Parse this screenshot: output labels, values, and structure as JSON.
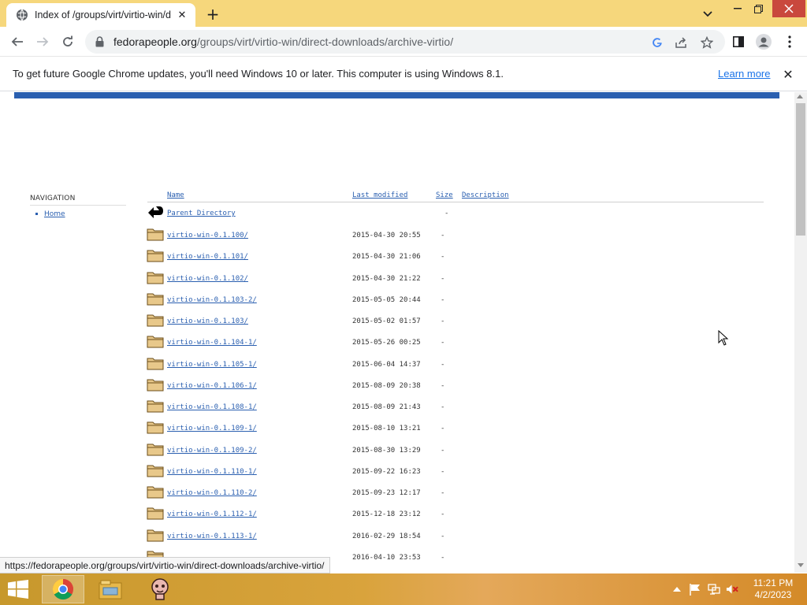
{
  "window": {
    "tab_title": "Index of /groups/virt/virtio-win/d",
    "tab_icons": {
      "favicon": "globe-icon",
      "close": "close-icon"
    },
    "new_tab_label": "+",
    "accent_color": "#f6d77c"
  },
  "toolbar": {
    "url_host": "fedorapeople.org",
    "url_path": "/groups/virt/virtio-win/direct-downloads/archive-virtio/",
    "icons": [
      "back-arrow-icon",
      "forward-arrow-icon",
      "reload-icon",
      "lock-icon",
      "google-icon",
      "share-icon",
      "star-icon",
      "side-panel-icon",
      "profile-icon",
      "kebab-menu-icon"
    ]
  },
  "infobar": {
    "message": "To get future Google Chrome updates, you'll need Windows 10 or later. This computer is using Windows 8.1.",
    "link": "Learn more",
    "close": "✕"
  },
  "page": {
    "navigation": {
      "heading": "NAVIGATION",
      "items": [
        "Home"
      ]
    },
    "columns": {
      "name": "Name",
      "last_modified": "Last modified",
      "size": "Size",
      "description": "Description"
    },
    "parent": {
      "name": "Parent Directory",
      "size": "-"
    },
    "rows": [
      {
        "name": "virtio-win-0.1.100/",
        "modified": "2015-04-30 20:55",
        "size": "-"
      },
      {
        "name": "virtio-win-0.1.101/",
        "modified": "2015-04-30 21:06",
        "size": "-"
      },
      {
        "name": "virtio-win-0.1.102/",
        "modified": "2015-04-30 21:22",
        "size": "-"
      },
      {
        "name": "virtio-win-0.1.103-2/",
        "modified": "2015-05-05 20:44",
        "size": "-"
      },
      {
        "name": "virtio-win-0.1.103/",
        "modified": "2015-05-02 01:57",
        "size": "-"
      },
      {
        "name": "virtio-win-0.1.104-1/",
        "modified": "2015-05-26 00:25",
        "size": "-"
      },
      {
        "name": "virtio-win-0.1.105-1/",
        "modified": "2015-06-04 14:37",
        "size": "-"
      },
      {
        "name": "virtio-win-0.1.106-1/",
        "modified": "2015-08-09 20:38",
        "size": "-"
      },
      {
        "name": "virtio-win-0.1.108-1/",
        "modified": "2015-08-09 21:43",
        "size": "-"
      },
      {
        "name": "virtio-win-0.1.109-1/",
        "modified": "2015-08-10 13:21",
        "size": "-"
      },
      {
        "name": "virtio-win-0.1.109-2/",
        "modified": "2015-08-30 13:29",
        "size": "-"
      },
      {
        "name": "virtio-win-0.1.110-1/",
        "modified": "2015-09-22 16:23",
        "size": "-"
      },
      {
        "name": "virtio-win-0.1.110-2/",
        "modified": "2015-09-23 12:17",
        "size": "-"
      },
      {
        "name": "virtio-win-0.1.112-1/",
        "modified": "2015-12-18 23:12",
        "size": "-"
      },
      {
        "name": "virtio-win-0.1.113-1/",
        "modified": "2016-02-29 18:54",
        "size": "-"
      },
      {
        "name": "",
        "modified": "2016-04-10 23:53",
        "size": "-"
      }
    ]
  },
  "status_bar": {
    "url": "https://fedorapeople.org/groups/virt/virtio-win/direct-downloads/archive-virtio/"
  },
  "taskbar": {
    "apps": [
      "chrome-icon",
      "file-explorer-icon",
      "game-icon"
    ],
    "tray": [
      "chevron-up-icon",
      "flag-icon",
      "network-icon",
      "volume-muted-icon"
    ],
    "time": "11:21 PM",
    "date": "4/2/2023"
  }
}
